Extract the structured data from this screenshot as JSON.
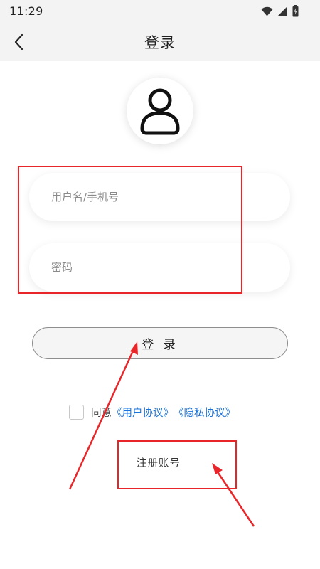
{
  "status_bar": {
    "time": "11:29",
    "icons": [
      "wifi-icon",
      "signal-icon",
      "battery-icon"
    ]
  },
  "header": {
    "title": "登录",
    "back_icon": "chevron-left-icon"
  },
  "avatar": {
    "icon": "user-icon"
  },
  "form": {
    "username_placeholder": "用户名/手机号",
    "username_value": "",
    "password_placeholder": "密码",
    "password_value": ""
  },
  "login_button": {
    "label": "登 录"
  },
  "agreement": {
    "checked": false,
    "prefix": "同意",
    "user_agreement": "《用户协议》",
    "privacy_policy": "《隐私协议》"
  },
  "register": {
    "label": "注册账号"
  },
  "annotation": {
    "color": "#e8262a"
  },
  "colors": {
    "link": "#1a73d9",
    "header_bg": "#f3f3f3"
  }
}
